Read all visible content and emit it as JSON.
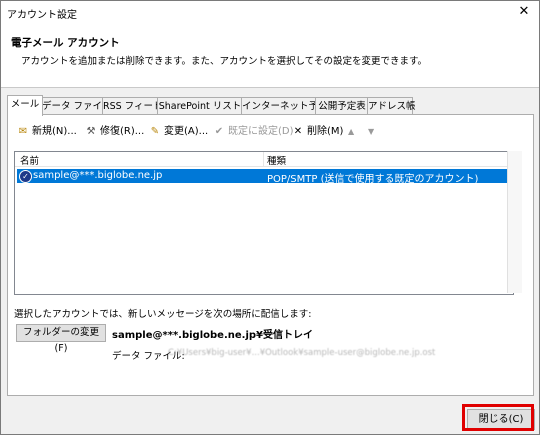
{
  "window": {
    "title": "アカウント設定",
    "close_glyph": "✕"
  },
  "header": {
    "heading": "電子メール アカウント",
    "description": "アカウントを追加または削除できます。また、アカウントを選択してその設定を変更できます。"
  },
  "tabs": [
    "メール",
    "データ ファイル",
    "RSS フィード",
    "SharePoint リスト",
    "インターネット予定表",
    "公開予定表",
    "アドレス帳"
  ],
  "toolbar": {
    "new": "新規(N)...",
    "repair": "修復(R)...",
    "change": "変更(A)...",
    "default": "既定に設定(D)",
    "delete": "削除(M)",
    "up_glyph": "▲",
    "down_glyph": "▼"
  },
  "list": {
    "columns": [
      "名前",
      "種類"
    ],
    "rows": [
      {
        "name": "sample@***.biglobe.ne.jp",
        "type": "POP/SMTP (送信で使用する既定のアカウント)"
      }
    ]
  },
  "delivery": {
    "label": "選択したアカウントでは、新しいメッセージを次の場所に配信します:",
    "folder_button": "フォルダーの変更(F)",
    "folder_path": "sample@***.biglobe.ne.jp¥受信トレイ",
    "data_file_label": "データ ファイル:",
    "data_file_value": "C:¥Users¥big-user¥...¥Outlook¥sample-user@biglobe.ne.jp.ost"
  },
  "footer": {
    "close_button": "閉じる(C)"
  },
  "colors": {
    "selection": "#0078d7",
    "highlight": "#e00000"
  }
}
